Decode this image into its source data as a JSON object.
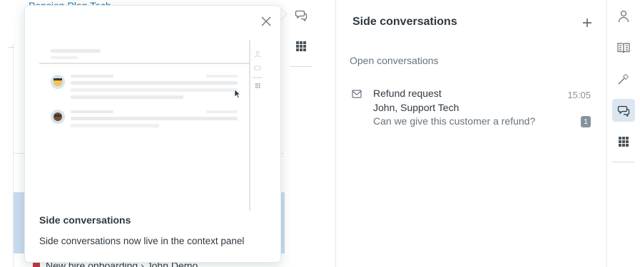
{
  "background": {
    "top_link_text": "Pension Plan Tech",
    "bottom_row_text": "New hire onboarding › John Demo"
  },
  "popover": {
    "title": "Side conversations",
    "body": "Side conversations now live in the context panel",
    "close_icon": "close-icon"
  },
  "panel": {
    "title": "Side conversations",
    "add_icon": "plus-icon",
    "section_label": "Open conversations",
    "conversations": [
      {
        "icon": "mail-icon",
        "subject": "Refund request",
        "time": "15:05",
        "participants": "John, Support Tech",
        "preview": "Can we give this customer a refund?",
        "count": "1"
      }
    ]
  },
  "mid_toolbar": {
    "icons": [
      "side-conversations-icon",
      "apps-grid-icon"
    ]
  },
  "rail": {
    "icons": [
      "user-icon",
      "knowledge-book-icon",
      "magic-wand-icon",
      "side-conversations-icon",
      "apps-grid-icon"
    ],
    "active": "side-conversations-icon"
  },
  "colors": {
    "accent": "#1f73b7",
    "selected_row": "#c9dcef",
    "active_rail": "#dbe6f0",
    "text": "#2f3941",
    "muted": "#68737d"
  }
}
